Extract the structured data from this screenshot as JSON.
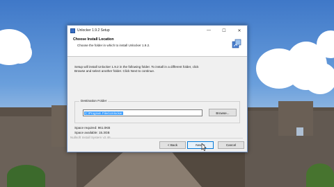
{
  "window": {
    "title": "Unlocker 1.9.2 Setup",
    "controls": {
      "minimize": "—",
      "maximize": "☐",
      "close": "✕"
    }
  },
  "header": {
    "title": "Choose Install Location",
    "subtitle": "Choose the folder in which to install Unlocker 1.9.2."
  },
  "instructions": {
    "line1": "Setup will install Unlocker 1.9.2 in the following folder. To install in a different folder, click",
    "line2": "Browse and select another folder. Click Next to continue."
  },
  "destination": {
    "label": "Destination Folder",
    "value": "C:\\Program Files\\Unlocker",
    "browse_label": "Browse..."
  },
  "space": {
    "required": "Space required: 961.0KB",
    "available": "Space available: 15.3GB"
  },
  "footer": {
    "brand": "Nullsoft Install System v2.46",
    "back_label": "< Back",
    "next_label": "Next >",
    "cancel_label": "Cancel"
  }
}
